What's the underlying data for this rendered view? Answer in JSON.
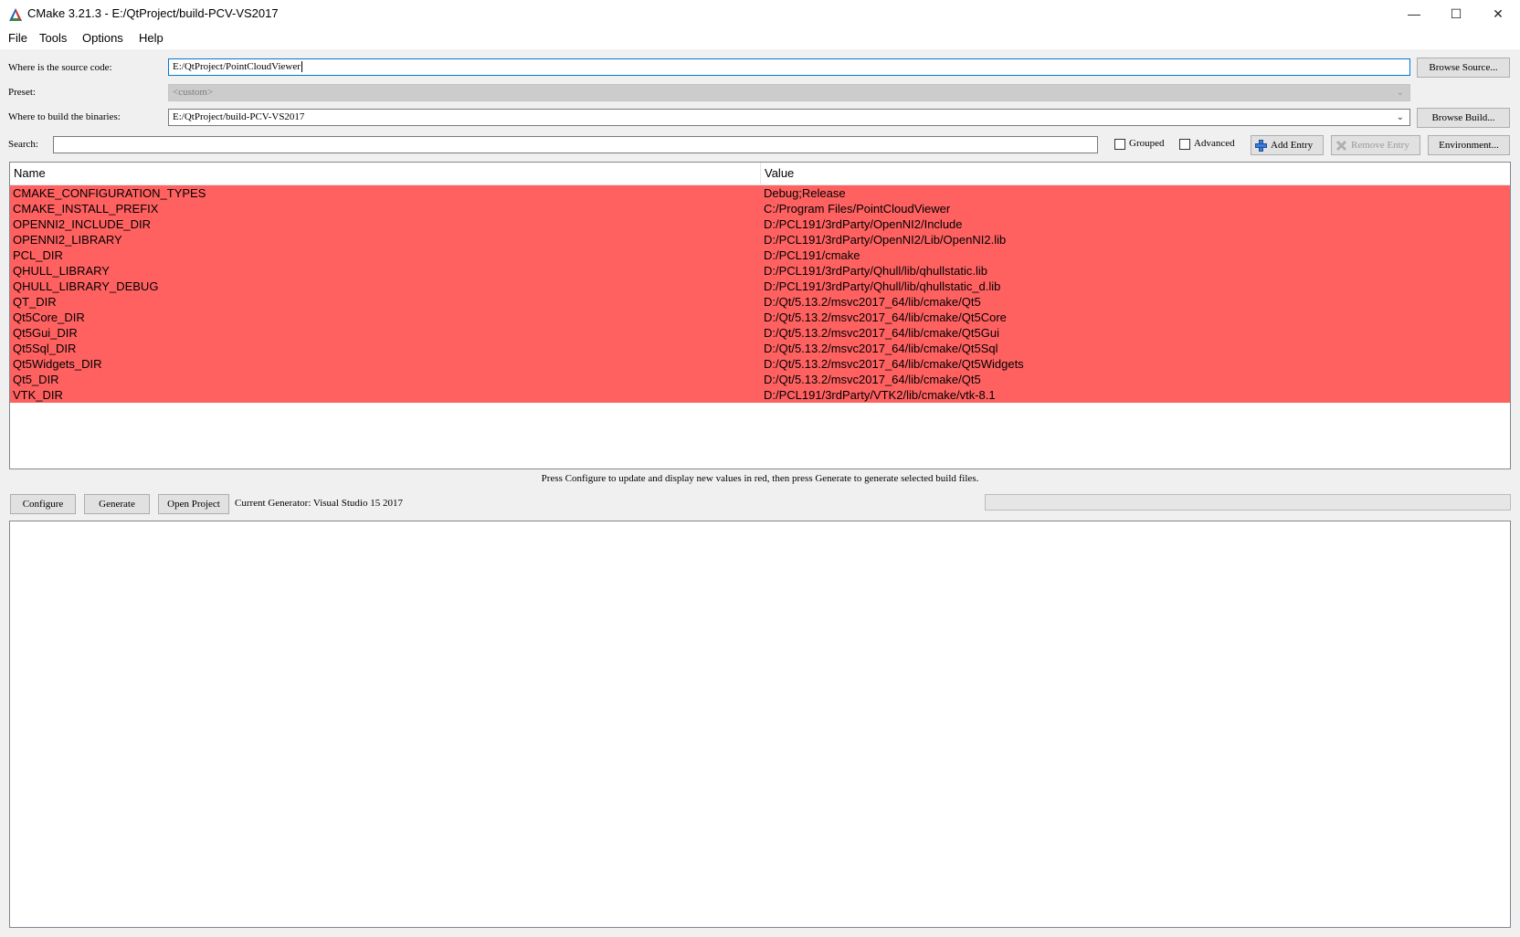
{
  "window": {
    "title": "CMake 3.21.3 - E:/QtProject/build-PCV-VS2017",
    "minimize_glyph": "—",
    "maximize_glyph": "☐",
    "close_glyph": "✕"
  },
  "menu": [
    "File",
    "Tools",
    "Options",
    "Help"
  ],
  "source": {
    "label": "Where is the source code:",
    "value": "E:/QtProject/PointCloudViewer",
    "browse_label": "Browse Source..."
  },
  "preset": {
    "label": "Preset:",
    "value": "<custom>"
  },
  "build": {
    "label": "Where to build the binaries:",
    "value": "E:/QtProject/build-PCV-VS2017",
    "browse_label": "Browse Build..."
  },
  "search": {
    "label": "Search:",
    "value": ""
  },
  "options": {
    "grouped_label": "Grouped",
    "advanced_label": "Advanced",
    "add_entry_label": "Add Entry",
    "remove_entry_label": "Remove Entry",
    "environment_label": "Environment..."
  },
  "table": {
    "columns": [
      "Name",
      "Value"
    ],
    "row_color": "#ff6161",
    "rows": [
      {
        "name": "CMAKE_CONFIGURATION_TYPES",
        "value": "Debug;Release"
      },
      {
        "name": "CMAKE_INSTALL_PREFIX",
        "value": "C:/Program Files/PointCloudViewer"
      },
      {
        "name": "OPENNI2_INCLUDE_DIR",
        "value": "D:/PCL191/3rdParty/OpenNI2/Include"
      },
      {
        "name": "OPENNI2_LIBRARY",
        "value": "D:/PCL191/3rdParty/OpenNI2/Lib/OpenNI2.lib"
      },
      {
        "name": "PCL_DIR",
        "value": "D:/PCL191/cmake"
      },
      {
        "name": "QHULL_LIBRARY",
        "value": "D:/PCL191/3rdParty/Qhull/lib/qhullstatic.lib"
      },
      {
        "name": "QHULL_LIBRARY_DEBUG",
        "value": "D:/PCL191/3rdParty/Qhull/lib/qhullstatic_d.lib"
      },
      {
        "name": "QT_DIR",
        "value": "D:/Qt/5.13.2/msvc2017_64/lib/cmake/Qt5"
      },
      {
        "name": "Qt5Core_DIR",
        "value": "D:/Qt/5.13.2/msvc2017_64/lib/cmake/Qt5Core"
      },
      {
        "name": "Qt5Gui_DIR",
        "value": "D:/Qt/5.13.2/msvc2017_64/lib/cmake/Qt5Gui"
      },
      {
        "name": "Qt5Sql_DIR",
        "value": "D:/Qt/5.13.2/msvc2017_64/lib/cmake/Qt5Sql"
      },
      {
        "name": "Qt5Widgets_DIR",
        "value": "D:/Qt/5.13.2/msvc2017_64/lib/cmake/Qt5Widgets"
      },
      {
        "name": "Qt5_DIR",
        "value": "D:/Qt/5.13.2/msvc2017_64/lib/cmake/Qt5"
      },
      {
        "name": "VTK_DIR",
        "value": "D:/PCL191/3rdParty/VTK2/lib/cmake/vtk-8.1"
      }
    ]
  },
  "hint": "Press Configure to update and display new values in red, then press Generate to generate selected build files.",
  "actions": {
    "configure_label": "Configure",
    "generate_label": "Generate",
    "open_project_label": "Open Project",
    "generator_text": "Current Generator: Visual Studio 15 2017"
  },
  "progress": 0
}
